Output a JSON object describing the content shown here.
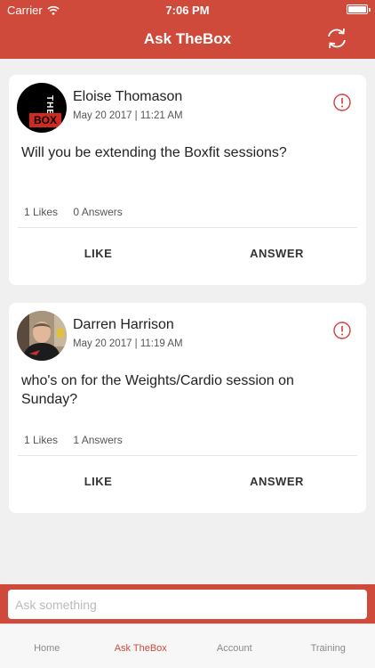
{
  "status_bar": {
    "carrier": "Carrier",
    "time": "7:06 PM"
  },
  "nav": {
    "title": "Ask TheBox",
    "refresh_icon": "refresh-icon"
  },
  "posts": [
    {
      "author": "Eloise Thomason",
      "date": "May 20 2017 | 11:21 AM",
      "question": "Will you be extending the Boxfit sessions?",
      "likes": "1 Likes",
      "answers": "0 Answers",
      "like_label": "LIKE",
      "answer_label": "ANSWER",
      "avatar_text_top": "THE",
      "avatar_text_bottom": "BOX"
    },
    {
      "author": "Darren Harrison",
      "date": "May 20 2017 | 11:19 AM",
      "question": "who's on for the Weights/Cardio session on Sunday?",
      "likes": "1 Likes",
      "answers": "1 Answers",
      "like_label": "LIKE",
      "answer_label": "ANSWER"
    }
  ],
  "ask": {
    "placeholder": "Ask something"
  },
  "tabs": [
    {
      "label": "Home"
    },
    {
      "label": "Ask TheBox",
      "active": true
    },
    {
      "label": "Account"
    },
    {
      "label": "Training"
    }
  ],
  "colors": {
    "accent": "#cf4a3a",
    "text": "#222222",
    "muted": "#8a8a8a",
    "background": "#f0f0f0"
  }
}
